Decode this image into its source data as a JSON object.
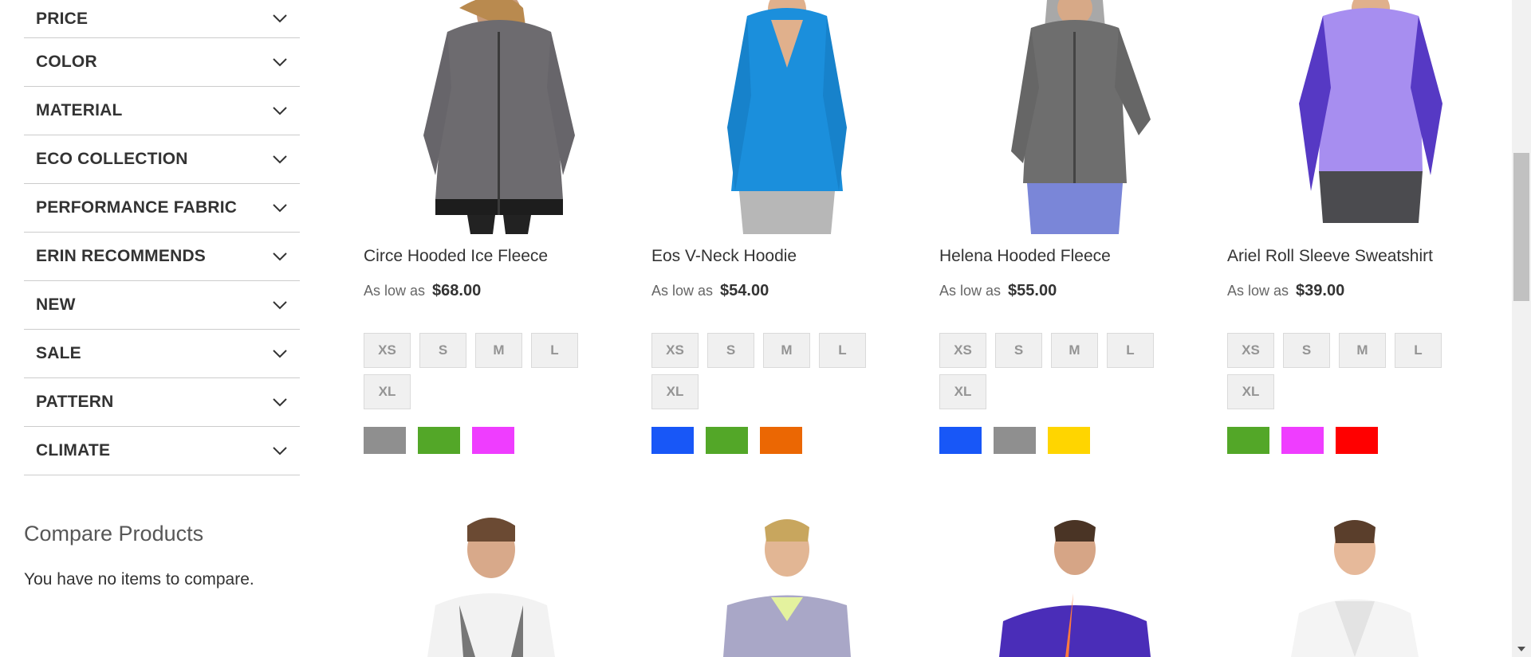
{
  "sidebar": {
    "filters": [
      {
        "label": "PRICE"
      },
      {
        "label": "COLOR"
      },
      {
        "label": "MATERIAL"
      },
      {
        "label": "ECO COLLECTION"
      },
      {
        "label": "PERFORMANCE FABRIC"
      },
      {
        "label": "ERIN RECOMMENDS"
      },
      {
        "label": "NEW"
      },
      {
        "label": "SALE"
      },
      {
        "label": "PATTERN"
      },
      {
        "label": "CLIMATE"
      }
    ],
    "compare": {
      "title": "Compare Products",
      "empty_text": "You have no items to compare."
    }
  },
  "products": [
    {
      "name": "Circe Hooded Ice Fleece",
      "price_prefix": "As low as",
      "price": "$68.00",
      "sizes": [
        "XS",
        "S",
        "M",
        "L",
        "XL"
      ],
      "colors": [
        "#8f8f8f",
        "#53a728",
        "#ef3dff"
      ]
    },
    {
      "name": "Eos V-Neck Hoodie",
      "price_prefix": "As low as",
      "price": "$54.00",
      "sizes": [
        "XS",
        "S",
        "M",
        "L",
        "XL"
      ],
      "colors": [
        "#1857f7",
        "#53a728",
        "#eb6703"
      ]
    },
    {
      "name": "Helena Hooded Fleece",
      "price_prefix": "As low as",
      "price": "$55.00",
      "sizes": [
        "XS",
        "S",
        "M",
        "L",
        "XL"
      ],
      "colors": [
        "#1857f7",
        "#8f8f8f",
        "#ffd500"
      ]
    },
    {
      "name": "Ariel Roll Sleeve Sweatshirt",
      "price_prefix": "As low as",
      "price": "$39.00",
      "sizes": [
        "XS",
        "S",
        "M",
        "L",
        "XL"
      ],
      "colors": [
        "#53a728",
        "#ef3dff",
        "#ff0000"
      ]
    }
  ]
}
